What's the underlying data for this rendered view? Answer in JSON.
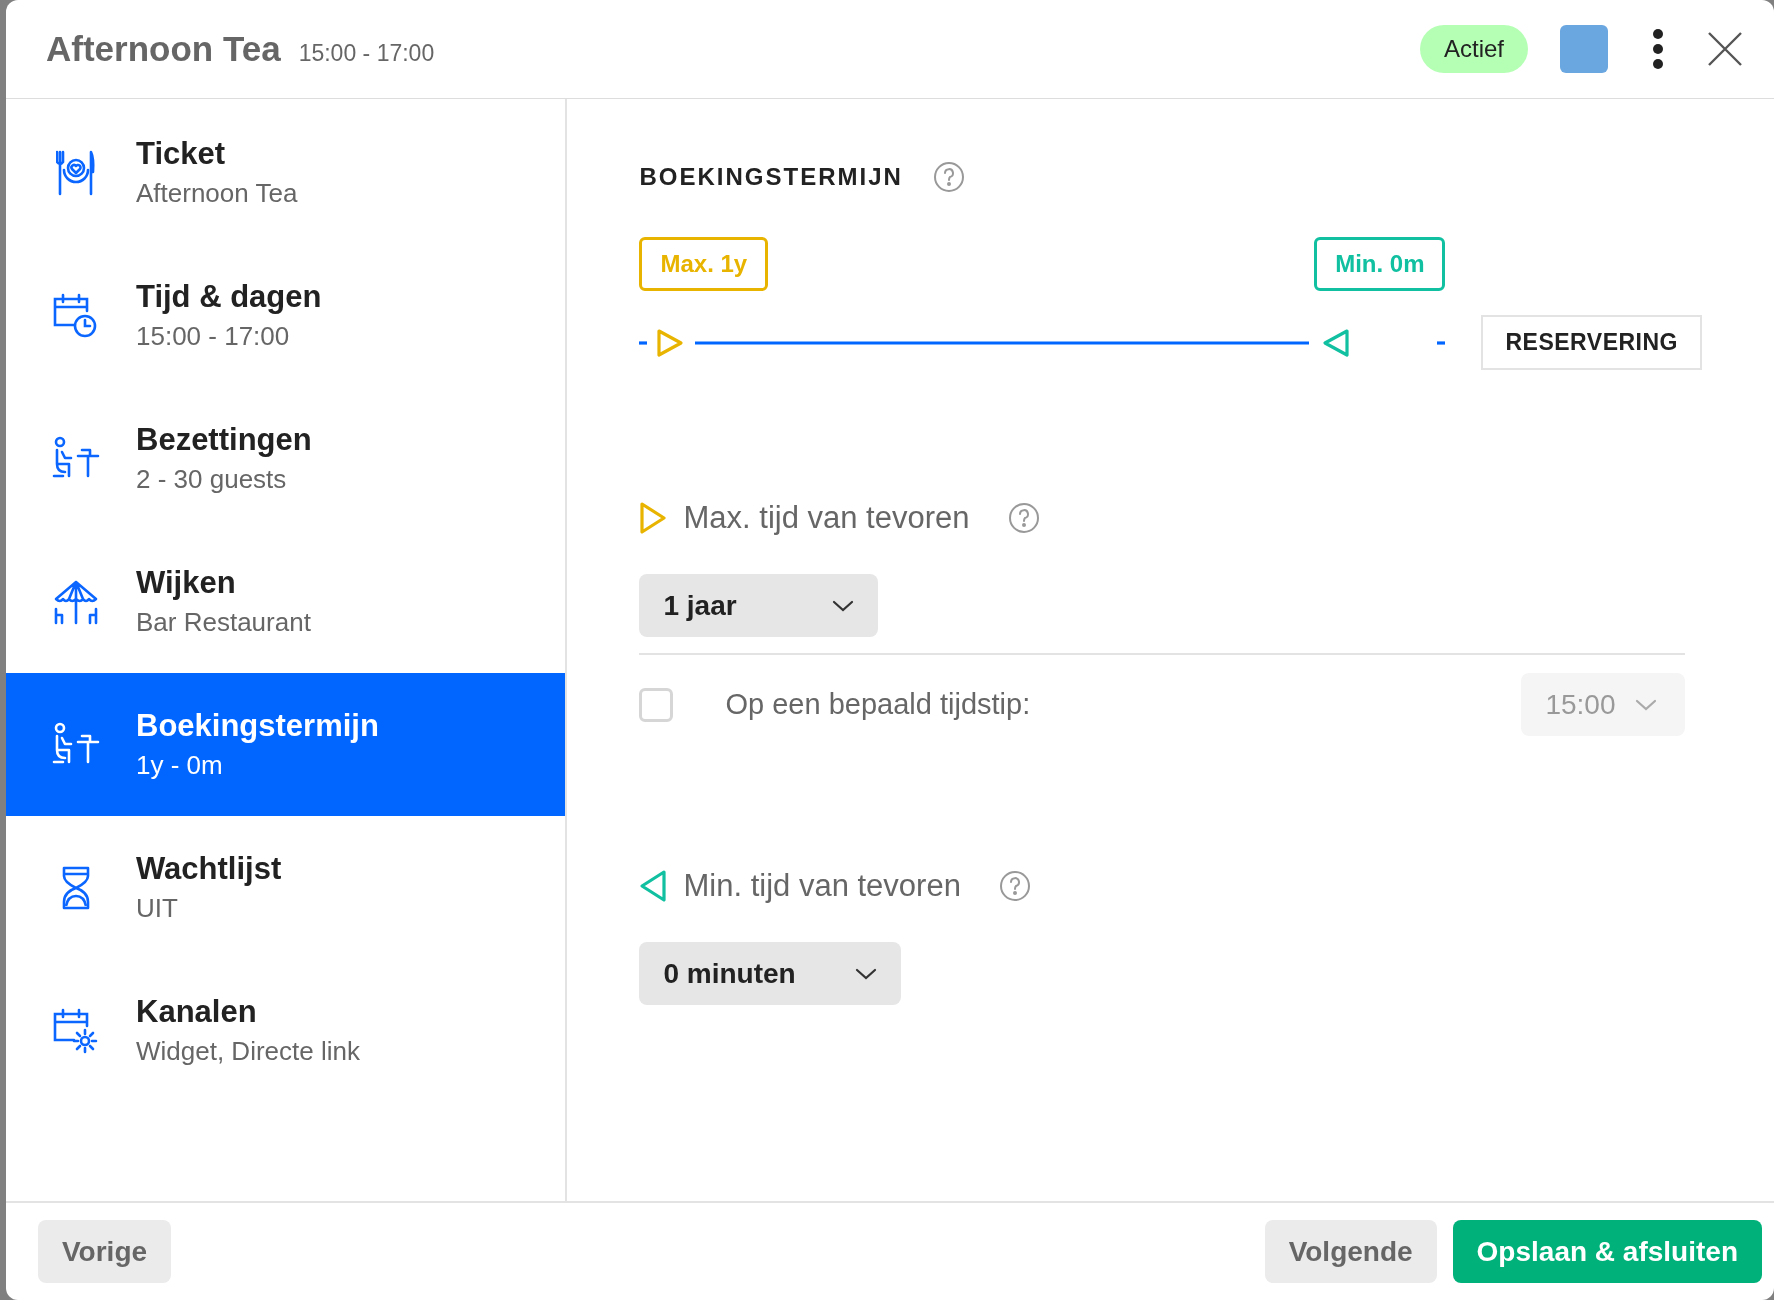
{
  "header": {
    "title": "Afternoon Tea",
    "subtitle": "15:00 - 17:00",
    "status": "Actief",
    "color": "#6aa6e0"
  },
  "sidebar": {
    "items": [
      {
        "kind": "ticket",
        "label": "Ticket",
        "sub": "Afternoon Tea",
        "selected": false
      },
      {
        "kind": "time",
        "label": "Tijd & dagen",
        "sub": "15:00 - 17:00",
        "selected": false
      },
      {
        "kind": "seating",
        "label": "Bezettingen",
        "sub": "2 - 30 guests",
        "selected": false
      },
      {
        "kind": "area",
        "label": "Wijken",
        "sub": "Bar Restaurant",
        "selected": false
      },
      {
        "kind": "seating",
        "label": "Boekingstermijn",
        "sub": "1y - 0m",
        "selected": true
      },
      {
        "kind": "waitlist",
        "label": "Wachtlijst",
        "sub": "UIT",
        "selected": false
      },
      {
        "kind": "channels",
        "label": "Kanalen",
        "sub": "Widget, Directe link",
        "selected": false
      }
    ]
  },
  "content": {
    "title": "BOEKINGSTERMIJN",
    "max_tag": "Max. 1y",
    "min_tag": "Min. 0m",
    "timeline_label": "RESERVERING",
    "max_field": {
      "label": "Max. tijd van tevoren",
      "value": "1 jaar"
    },
    "specific_time": {
      "label": "Op een bepaald tijdstip:",
      "checked": false,
      "value": "15:00",
      "disabled": true
    },
    "min_field": {
      "label": "Min. tijd van tevoren",
      "value": "0 minuten"
    }
  },
  "footer": {
    "back": "Vorige",
    "next": "Volgende",
    "save": "Opslaan & afsluiten"
  }
}
